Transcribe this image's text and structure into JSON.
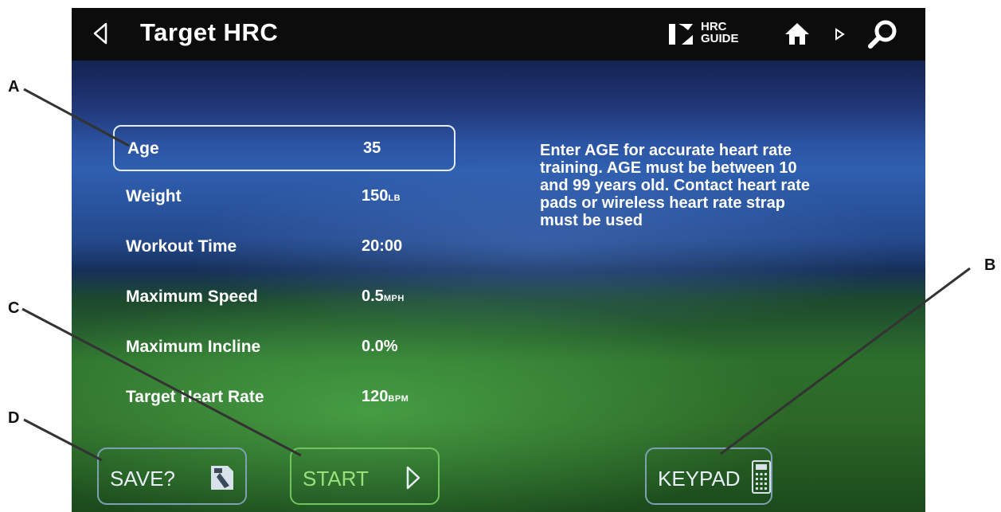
{
  "header": {
    "title": "Target HRC",
    "guide_line1": "HRC",
    "guide_line2": "GUIDE",
    "icons": [
      "back-icon",
      "hrc-guide-icon",
      "home-icon",
      "next-icon",
      "search-icon"
    ]
  },
  "settings": [
    {
      "label": "Age",
      "value": "35",
      "unit": "",
      "selected": true
    },
    {
      "label": "Weight",
      "value": "150",
      "unit": "LB"
    },
    {
      "label": "Workout Time",
      "value": "20:00",
      "unit": ""
    },
    {
      "label": "Maximum Speed",
      "value": "0.5",
      "unit": "MPH"
    },
    {
      "label": "Maximum Incline",
      "value": "0.0%",
      "unit": ""
    },
    {
      "label": "Target Heart Rate",
      "value": "120",
      "unit": "BPM"
    }
  ],
  "info_text": "Enter AGE for accurate heart rate training. AGE must be between 10 and 99 years old. Contact heart rate pads or wireless heart rate strap must be used",
  "buttons": {
    "save": "SAVE?",
    "start": "START",
    "keypad": "KEYPAD"
  },
  "callouts": {
    "a": "A",
    "b": "B",
    "c": "C",
    "d": "D"
  },
  "colors": {
    "start_accent": "#6fc45b",
    "button_border": "#7ea0b7",
    "topbar": "#0c0c0c"
  }
}
